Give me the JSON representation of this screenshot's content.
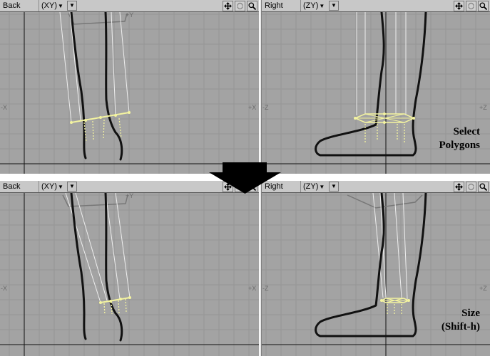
{
  "viewports": [
    {
      "name": "Back",
      "axis": "(XY)",
      "axis_labels": {
        "top": "+Y",
        "left": "-X",
        "right": "+X"
      }
    },
    {
      "name": "Right",
      "axis": "(ZY)",
      "axis_labels": {
        "left": "-Z",
        "right": "+Z"
      }
    },
    {
      "name": "Back",
      "axis": "(XY)",
      "axis_labels": {
        "top": "+Y",
        "left": "-X",
        "right": "+X"
      }
    },
    {
      "name": "Right",
      "axis": "(ZY)",
      "axis_labels": {
        "left": "-Z",
        "right": "+Z"
      }
    }
  ],
  "steps": [
    {
      "line1": "Select",
      "line2": "Polygons"
    },
    {
      "line1": "Size",
      "line2": "(Shift-h)"
    }
  ],
  "icons": [
    "move-icon",
    "rotate-icon",
    "zoom-icon",
    "dropdown-icon",
    "down-arrow-icon"
  ],
  "colors": {
    "viewport": "#a3a3a3",
    "grid": "#969696",
    "header": "#c8c8c8",
    "selection": "#f4f4a0",
    "outline": "#111111"
  }
}
